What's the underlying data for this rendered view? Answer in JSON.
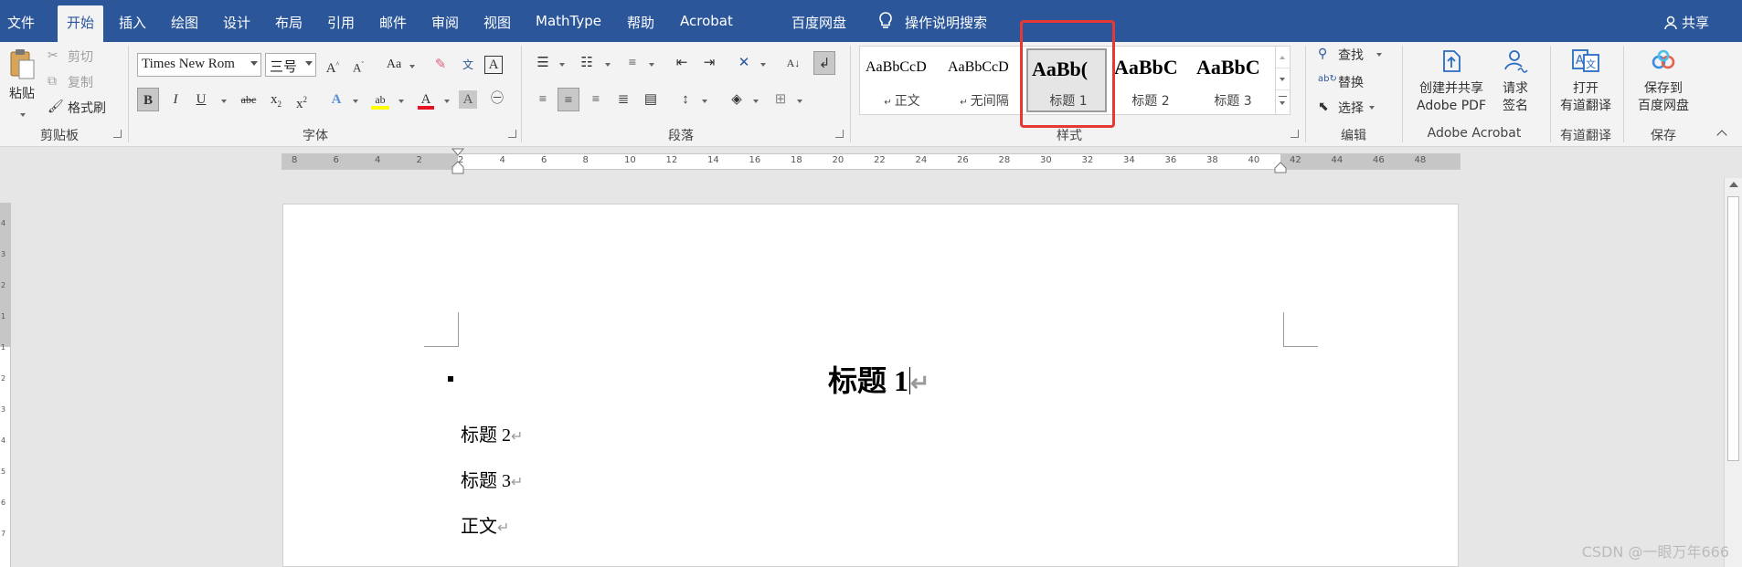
{
  "tabs": [
    {
      "label": "文件"
    },
    {
      "label": "开始"
    },
    {
      "label": "插入"
    },
    {
      "label": "绘图"
    },
    {
      "label": "设计"
    },
    {
      "label": "布局"
    },
    {
      "label": "引用"
    },
    {
      "label": "邮件"
    },
    {
      "label": "审阅"
    },
    {
      "label": "视图"
    },
    {
      "label": "MathType"
    },
    {
      "label": "帮助"
    },
    {
      "label": "Acrobat"
    },
    {
      "label": "百度网盘"
    }
  ],
  "active_tab": "开始",
  "search_label": "操作说明搜索",
  "share_label": "共享",
  "clipboard": {
    "paste": "粘贴",
    "cut": "剪切",
    "copy": "复制",
    "format_painter": "格式刷",
    "group": "剪贴板"
  },
  "font": {
    "name": "Times New Rom",
    "size": "三号",
    "group": "字体"
  },
  "paragraph": {
    "group": "段落"
  },
  "styles": {
    "group": "样式",
    "items": [
      {
        "sample": "AaBbCcD",
        "name": "正文"
      },
      {
        "sample": "AaBbCcD",
        "name": "无间隔"
      },
      {
        "sample": "AaBb(",
        "name": "标题 1"
      },
      {
        "sample": "AaBbC",
        "name": "标题 2"
      },
      {
        "sample": "AaBbC",
        "name": "标题 3"
      }
    ],
    "selected": "标题 1"
  },
  "editing": {
    "find": "查找",
    "replace": "替换",
    "select": "选择",
    "group": "编辑"
  },
  "acrobat": {
    "create_share_l1": "创建并共享",
    "create_share_l2": "Adobe PDF",
    "request_sign_l1": "请求",
    "request_sign_l2": "签名",
    "group": "Adobe Acrobat"
  },
  "youdao": {
    "open_l1": "打开",
    "open_l2": "有道翻译",
    "group": "有道翻译"
  },
  "save": {
    "save_l1": "保存到",
    "save_l2": "百度网盘",
    "group": "保存"
  },
  "ruler_numbers": [
    "8",
    "6",
    "4",
    "2",
    "2",
    "4",
    "6",
    "8",
    "10",
    "12",
    "14",
    "16",
    "18",
    "20",
    "22",
    "24",
    "26",
    "28",
    "30",
    "32",
    "34",
    "36",
    "38",
    "40",
    "42",
    "44",
    "46",
    "48"
  ],
  "document": {
    "heading1": "标题 1",
    "heading2": "标题 2",
    "heading3": "标题 3",
    "body": "正文",
    "mark": "↵"
  },
  "watermark": "CSDN @一眼万年666",
  "colors": {
    "ribbon_blue": "#2b579a",
    "highlight_red": "#e53935",
    "font_red": "#e81123",
    "highlight_yellow": "#ffff00"
  }
}
